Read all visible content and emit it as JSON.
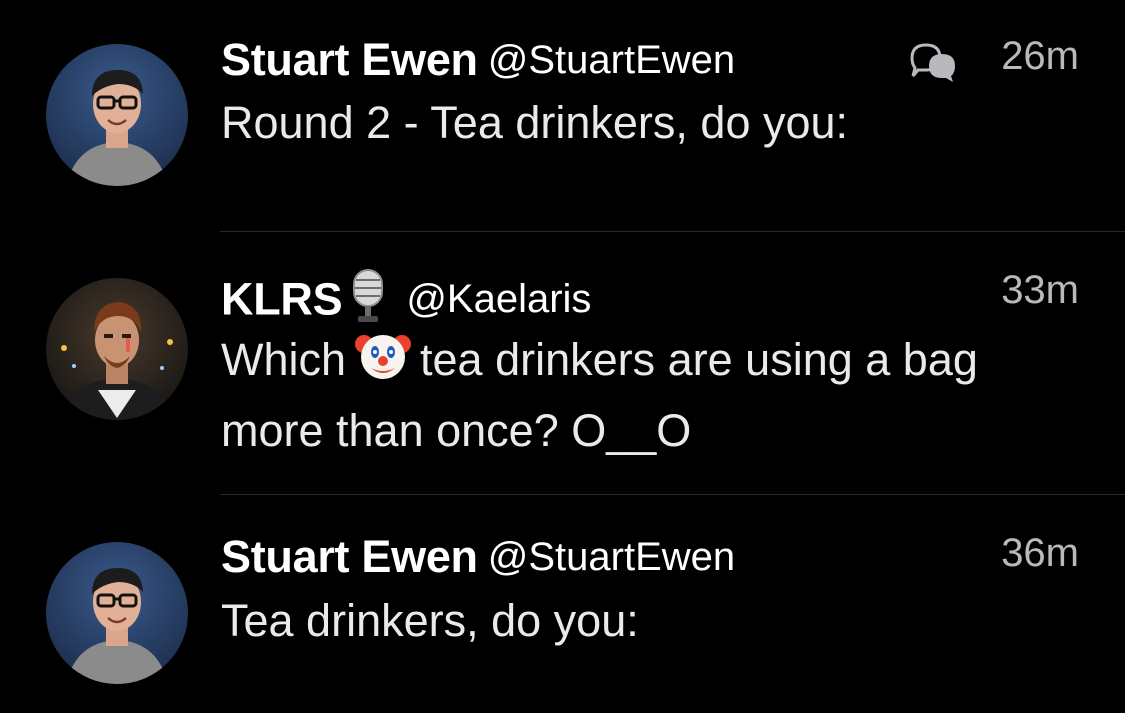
{
  "tweets": [
    {
      "name": "Stuart Ewen",
      "handle": "@StuartEwen",
      "time": "26m",
      "text": "Round 2 - Tea drinkers, do you:",
      "has_conversation_icon": true,
      "avatar": "stuart-avatar"
    },
    {
      "name": "KLRS",
      "name_emoji": "microphone-emoji",
      "handle": "@Kaelaris",
      "time": "33m",
      "text_before_emoji": "Which",
      "inline_emoji": "clown-emoji",
      "text_after_emoji": "tea drinkers are using a bag more than once? O__O",
      "avatar": "klrs-avatar"
    },
    {
      "name": "Stuart Ewen",
      "handle": "@StuartEwen",
      "time": "36m",
      "text": "Tea drinkers, do you:",
      "avatar": "stuart-avatar"
    }
  ],
  "colors": {
    "background": "#000000",
    "name": "#ffffff",
    "body_text": "#eaeaea",
    "timestamp": "#b9b9bd",
    "divider": "#2a2a2c"
  }
}
